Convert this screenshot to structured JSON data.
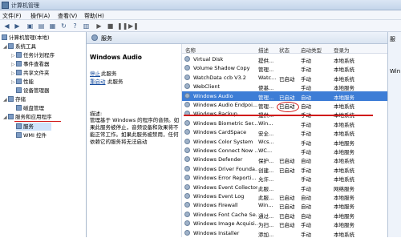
{
  "window": {
    "title": "计算机管理"
  },
  "menu": [
    "文件(F)",
    "操作(A)",
    "查看(V)",
    "帮助(H)"
  ],
  "tree": {
    "root": "计算机管理(本地)",
    "system_tools": "系统工具",
    "task_scheduler": "任务计划程序",
    "event_viewer": "事件查看器",
    "shared_folders": "共享文件夹",
    "performance": "性能",
    "device_manager": "设备管理器",
    "storage": "存储",
    "disk_management": "磁盘管理",
    "services_apps": "服务和应用程序",
    "services": "服务",
    "wmi": "WMI 控件"
  },
  "center": {
    "header": "服务",
    "selected_service": "Windows Audio",
    "stop_link": "停止",
    "stop_rest": "此服务",
    "restart_link": "重启动",
    "restart_rest": "此服务",
    "desc_label": "描述:",
    "description": "管理基于 Windows 的程序的音频。如果此服务被停止，音频设备和效果将不能正常工作。如果此服务被禁用，任何依赖它的服务将无法启动"
  },
  "columns": {
    "name": "名称",
    "desc": "描述",
    "status": "状态",
    "startup": "启动类型",
    "logon": "登录为"
  },
  "rows": [
    {
      "name": "Virtual Disk",
      "desc": "提供...",
      "status": "",
      "startup": "手动",
      "logon": "本地系统"
    },
    {
      "name": "Volume Shadow Copy",
      "desc": "管理...",
      "status": "",
      "startup": "手动",
      "logon": "本地系统"
    },
    {
      "name": "WatchData ccb V3.2",
      "desc": "Watc...",
      "status": "已启动",
      "startup": "手动",
      "logon": "本地系统"
    },
    {
      "name": "WebClient",
      "desc": "使基...",
      "status": "",
      "startup": "手动",
      "logon": "本地服务"
    },
    {
      "name": "Windows Audio",
      "desc": "管理...",
      "status": "已启动",
      "startup": "自动",
      "logon": "本地服务"
    },
    {
      "name": "Windows Audio Endpoi...",
      "desc": "管理...",
      "status": "已启动",
      "startup": "自动",
      "logon": "本地系统"
    },
    {
      "name": "Windows Backup",
      "desc": "提供...",
      "status": "",
      "startup": "手动",
      "logon": "本地系统"
    },
    {
      "name": "Windows Biometric Ser...",
      "desc": "Win...",
      "status": "",
      "startup": "手动",
      "logon": "本地系统"
    },
    {
      "name": "Windows CardSpace",
      "desc": "安全...",
      "status": "",
      "startup": "手动",
      "logon": "本地系统"
    },
    {
      "name": "Windows Color System",
      "desc": "Wcs...",
      "status": "",
      "startup": "手动",
      "logon": "本地服务"
    },
    {
      "name": "Windows Connect Now ...",
      "desc": "WC...",
      "status": "",
      "startup": "手动",
      "logon": "本地服务"
    },
    {
      "name": "Windows Defender",
      "desc": "保护...",
      "status": "已启动",
      "startup": "自动",
      "logon": "本地系统"
    },
    {
      "name": "Windows Driver Founda...",
      "desc": "创建...",
      "status": "已启动",
      "startup": "手动",
      "logon": "本地系统"
    },
    {
      "name": "Windows Error Reporti...",
      "desc": "允许...",
      "status": "",
      "startup": "手动",
      "logon": "本地系统"
    },
    {
      "name": "Windows Event Collector",
      "desc": "此服...",
      "status": "",
      "startup": "手动",
      "logon": "网络服务"
    },
    {
      "name": "Windows Event Log",
      "desc": "此服...",
      "status": "已启动",
      "startup": "自动",
      "logon": "本地服务"
    },
    {
      "name": "Windows Firewall",
      "desc": "Win...",
      "status": "已启动",
      "startup": "自动",
      "logon": "本地服务"
    },
    {
      "name": "Windows Font Cache Se...",
      "desc": "通过...",
      "status": "已启动",
      "startup": "自动",
      "logon": "本地服务"
    },
    {
      "name": "Windows Image Acquisi...",
      "desc": "为扫...",
      "status": "已启动",
      "startup": "手动",
      "logon": "本地服务"
    },
    {
      "name": "Windows Installer",
      "desc": "添加...",
      "status": "",
      "startup": "手动",
      "logon": "本地系统"
    }
  ],
  "actions": {
    "title": "服",
    "item": "Win"
  },
  "accent": {
    "annotation_red": "#d01a1a",
    "selection_blue": "#3d7dd6"
  }
}
